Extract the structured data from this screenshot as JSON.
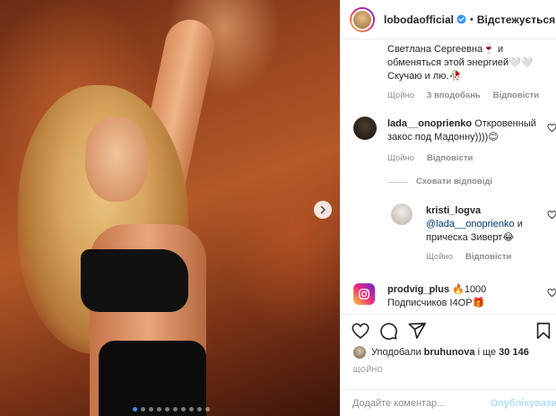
{
  "post": {
    "author": "lobodaofficial",
    "header_separator": "•",
    "follow_state": "Відстежується"
  },
  "comments": [
    {
      "text_line1": "Светлана Сергеевна🍷 и",
      "text_line2": "обменяться этой энергией🤍🤍",
      "text_line3": "Скучаю и лю.🥀",
      "meta": [
        "Щойно",
        "3 вподобань",
        "Відповісти"
      ]
    },
    {
      "username": "lada__onoprienko",
      "text_line1": "Откровенный",
      "text_line2": "закос под Мадонну))))😊",
      "meta": [
        "Щойно",
        "Відповісти"
      ]
    }
  ],
  "thread_toggle": "Сховати відповіді",
  "reply": {
    "username": "kristi_logva",
    "mention": "@lada__onoprienko",
    "text_after_mention": " и",
    "text_line2": "причеcка Зиверт😂",
    "meta": [
      "Щойно",
      "Відповісти"
    ]
  },
  "promo_comment": {
    "username": "prodvig_plus",
    "text_line1": "🔥1000",
    "text_line2": "Подписчиков I4OP🎁",
    "meta": [
      "Щойно"
    ]
  },
  "likes": {
    "prefix": "Уподобали",
    "user": "bruhunova",
    "suffix_prefix": "і ще",
    "count": "30 146"
  },
  "timestamp": "ЩОЙНО",
  "comment_input": {
    "placeholder": "Додайте коментар..."
  },
  "publish_label": "Опублікувати",
  "carousel": {
    "slides": 10,
    "active_index": 0
  },
  "colors": {
    "accent_blue": "#0095f6",
    "verified_blue": "#3897f0",
    "muted": "#8e8e8e"
  },
  "icons": [
    "heart-icon",
    "comment-icon",
    "share-icon",
    "bookmark-icon",
    "verified-icon",
    "chevron-right-icon"
  ]
}
